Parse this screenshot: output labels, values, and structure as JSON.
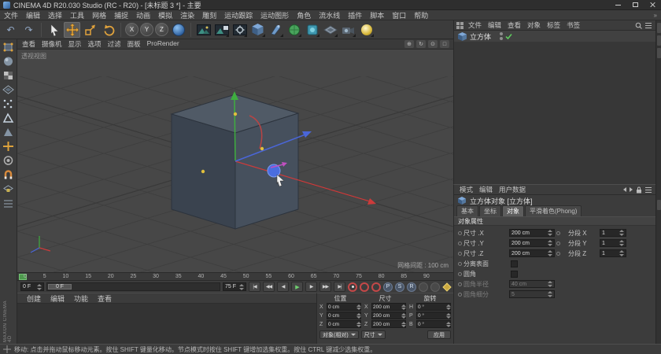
{
  "window": {
    "title": "CINEMA 4D R20.030 Studio (RC - R20) - [未标题 3 *] - 主要"
  },
  "menubar": {
    "items": [
      "文件",
      "编辑",
      "选择",
      "工具",
      "网格",
      "捕捉",
      "动画",
      "模拟",
      "渲染",
      "雕刻",
      "运动跟踪",
      "运动图形",
      "角色",
      "流水线",
      "插件",
      "脚本",
      "窗口",
      "帮助"
    ]
  },
  "toolbar": {
    "axis_labels": [
      "X",
      "Y",
      "Z"
    ]
  },
  "icons": {
    "undo": "↶",
    "redo": "↷",
    "pan": "⊕",
    "orbit": "↻",
    "zoom": "⊙",
    "maximize": "□",
    "overflow": "»"
  },
  "viewport": {
    "menu_items": [
      "查看",
      "摄像机",
      "显示",
      "选项",
      "过滤",
      "面板",
      "ProRender"
    ],
    "view_label": "透视视图",
    "grid_label": "网格间距 : 100 cm"
  },
  "timeline": {
    "ticks": [
      "0",
      "5",
      "10",
      "15",
      "20",
      "25",
      "30",
      "35",
      "40",
      "45",
      "50",
      "55",
      "60",
      "65",
      "70",
      "75",
      "80",
      "85",
      "90"
    ],
    "current_frame": "0 F",
    "slider_label": "0 F",
    "end_frame": "75 F"
  },
  "transport": {
    "buttons": [
      "|◀",
      "◀◀",
      "◀",
      "▶",
      "▶",
      "▶▶",
      "▶|"
    ],
    "toggle_letters": [
      "P",
      "S",
      "R"
    ]
  },
  "materials": {
    "menu_items": [
      "创建",
      "编辑",
      "功能",
      "查看"
    ]
  },
  "coords": {
    "position": {
      "title": "位置",
      "rows": [
        {
          "a": "X",
          "v": "0 cm"
        },
        {
          "a": "Y",
          "v": "0 cm"
        },
        {
          "a": "Z",
          "v": "0 cm"
        }
      ]
    },
    "size": {
      "title": "尺寸",
      "rows": [
        {
          "a": "X",
          "v": "200 cm"
        },
        {
          "a": "Y",
          "v": "200 cm"
        },
        {
          "a": "Z",
          "v": "200 cm"
        }
      ]
    },
    "rotation": {
      "title": "旋转",
      "rows": [
        {
          "a": "H",
          "v": "0 °"
        },
        {
          "a": "P",
          "v": "0 °"
        },
        {
          "a": "B",
          "v": "0 °"
        }
      ]
    },
    "mode": "对象(相对)",
    "size_mode": "尺寸",
    "apply": "应用"
  },
  "object_manager": {
    "menu_items": [
      "文件",
      "编辑",
      "查看",
      "对象",
      "标签",
      "书签"
    ],
    "objects": [
      {
        "name": "立方体"
      }
    ]
  },
  "attributes": {
    "menu_items": [
      "模式",
      "编辑",
      "用户数据"
    ],
    "title": "立方体对象 [立方体]",
    "tabs": [
      "基本",
      "坐标",
      "对象",
      "平滑着色(Phong)"
    ],
    "section": "对象属性",
    "rows": [
      {
        "l1": "尺寸 .X",
        "v1": "200 cm",
        "l2": "分段 X",
        "v2": "1"
      },
      {
        "l1": "尺寸 .Y",
        "v1": "200 cm",
        "l2": "分段 Y",
        "v2": "1"
      },
      {
        "l1": "尺寸 .Z",
        "v1": "200 cm",
        "l2": "分段 Z",
        "v2": "1"
      }
    ],
    "checks": [
      {
        "label": "分离表面"
      },
      {
        "label": "圆角"
      }
    ],
    "disabled": [
      {
        "label": "圆角半径",
        "value": "40 cm"
      },
      {
        "label": "圆角细分",
        "value": "5"
      }
    ]
  },
  "statusbar": {
    "text": "移动: 点击并拖动鼠标移动元素。按住 SHIFT 键量化移动。节点模式时按住 SHIFT 键增加选集权重。按住 CTRL 键减少选集权重。"
  },
  "branding": {
    "vertical_text": "MAXON CINEMA 4D"
  }
}
